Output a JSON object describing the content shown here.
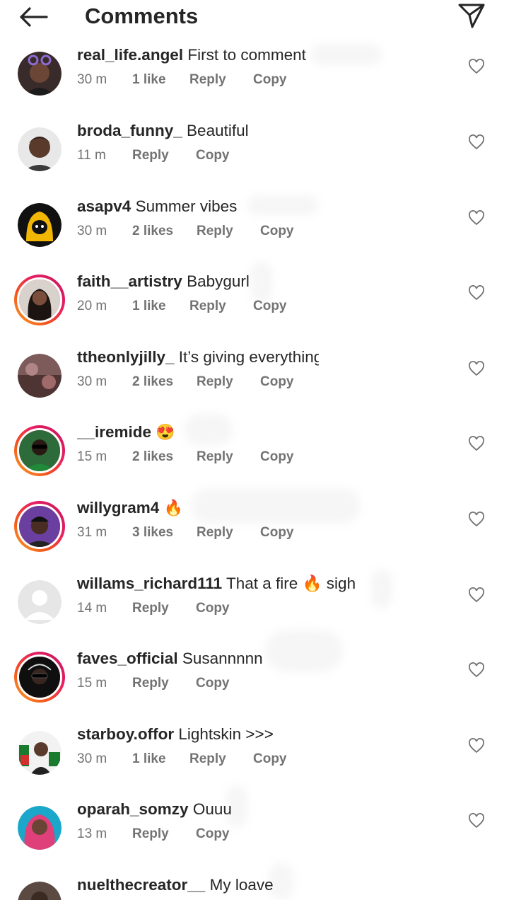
{
  "header": {
    "title": "Comments"
  },
  "actions": {
    "reply": "Reply",
    "copy": "Copy"
  },
  "icons": {
    "back": "arrow-left-icon",
    "share": "paper-plane-icon",
    "like": "heart-outline-icon"
  },
  "colors": {
    "story_ring_start": "#f9a825",
    "story_ring_end": "#c2185b",
    "meta_text": "#737373"
  },
  "comments": [
    {
      "username": "real_life.angel",
      "text": "First to comment",
      "time": "30 m",
      "likes": "1 like",
      "story_ring": false
    },
    {
      "username": "broda_funny_",
      "text": "Beautiful",
      "time": "11 m",
      "likes": "",
      "story_ring": false
    },
    {
      "username": "asapv4",
      "text": "Summer vibes",
      "time": "30 m",
      "likes": "2 likes",
      "story_ring": false
    },
    {
      "username": "faith__artistry",
      "text": "Babygurl",
      "time": "20 m",
      "likes": "1 like",
      "story_ring": true
    },
    {
      "username": "ttheonlyjilly_",
      "text": "It’s giving everything",
      "time": "30 m",
      "likes": "2 likes",
      "story_ring": false
    },
    {
      "username": "__iremide",
      "text": "😍",
      "time": "15 m",
      "likes": "2 likes",
      "story_ring": true
    },
    {
      "username": "willygram4",
      "text": "🔥",
      "time": "31 m",
      "likes": "3 likes",
      "story_ring": true
    },
    {
      "username": "willams_richard111",
      "text": "That a fire 🔥 sigh",
      "time": "14 m",
      "likes": "",
      "story_ring": false
    },
    {
      "username": "faves_official",
      "text": "Susannnnn",
      "time": "15 m",
      "likes": "",
      "story_ring": true
    },
    {
      "username": "starboy.offor",
      "text": "Lightskin >>>",
      "time": "30 m",
      "likes": "1 like",
      "story_ring": false
    },
    {
      "username": "oparah_somzy",
      "text": "Ouuu",
      "time": "13 m",
      "likes": "",
      "story_ring": false
    },
    {
      "username": "nuelthecreator__",
      "text": "My loave",
      "time": "",
      "likes": "",
      "story_ring": false
    }
  ]
}
